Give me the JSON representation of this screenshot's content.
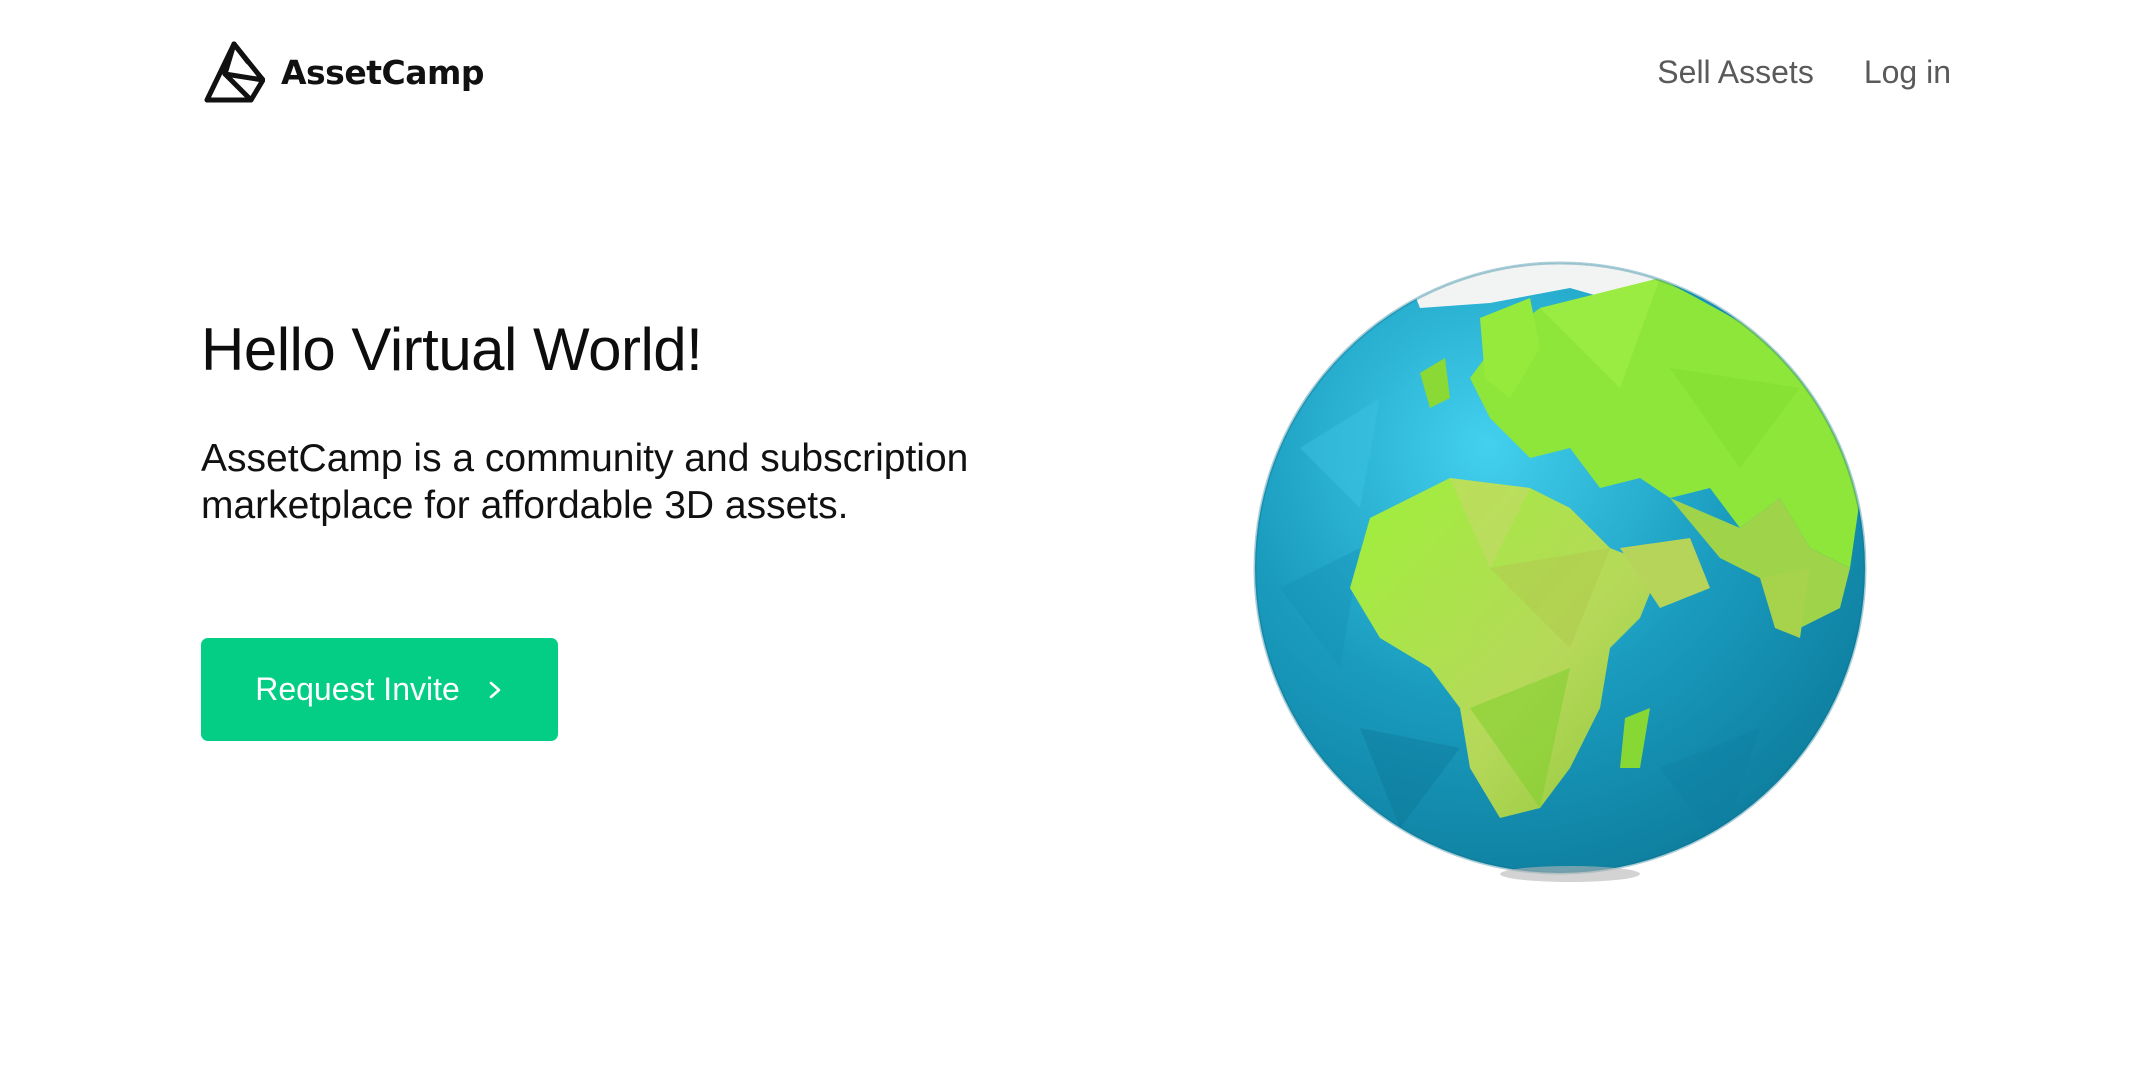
{
  "brand": {
    "name": "AssetCamp",
    "logo_icon": "assetcamp-logo-icon"
  },
  "nav": {
    "items": [
      {
        "label": "Sell Assets"
      },
      {
        "label": "Log in"
      }
    ]
  },
  "hero": {
    "title": "Hello Virtual World!",
    "subtitle_line1": "AssetCamp is a community and subscription",
    "subtitle_line2": "marketplace for affordable 3D assets."
  },
  "cta": {
    "label": "Request Invite",
    "icon": "chevron-right-icon",
    "color": "#04cd86"
  },
  "illustration": {
    "name": "low-poly-globe-illustration",
    "ocean_color": "#1a9cbf",
    "land_color": "#a8d64a"
  }
}
